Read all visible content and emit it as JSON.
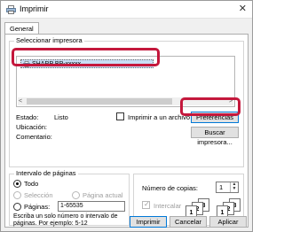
{
  "window": {
    "title": "Imprimir",
    "close": "✕"
  },
  "tabs": [
    {
      "label": "General"
    }
  ],
  "printer_section": {
    "title": "Seleccionar impresora",
    "printers": [
      {
        "name": "SHARP BP-xxxxx",
        "selected": true
      }
    ],
    "scroll_left": "<",
    "scroll_right": ">"
  },
  "status": {
    "estado_label": "Estado:",
    "estado_value": "Listo",
    "ubicacion_label": "Ubicación:",
    "comentario_label": "Comentario:",
    "print_to_file_label": "Imprimir a un archivo",
    "print_to_file_checked": false,
    "preferences_button": "Preferencias",
    "find_printer_button": "Buscar impresora..."
  },
  "page_range": {
    "title": "Intervalo de páginas",
    "all_label": "Todo",
    "selection_label": "Selección",
    "current_page_label": "Página actual",
    "pages_label": "Páginas:",
    "pages_value": "1-65535",
    "hint": "Escriba un solo número o intervalo de páginas. Por ejemplo: 5-12",
    "selected": "all"
  },
  "copies": {
    "label": "Número de copias:",
    "value": "1",
    "collate_label": "Intercalar",
    "collate_checked": true
  },
  "buttons": {
    "print": "Imprimir",
    "cancel": "Cancelar",
    "apply": "Aplicar"
  },
  "highlight_color": "#c4183c"
}
